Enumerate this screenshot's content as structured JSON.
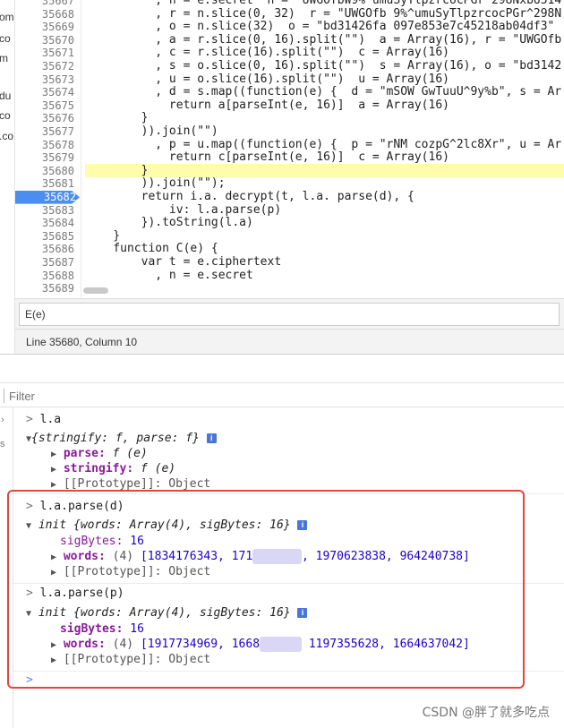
{
  "sidebar": {
    "fragments": [
      "om",
      "co",
      "m",
      "du",
      "co",
      ".co"
    ]
  },
  "editor": {
    "line_numbers": [
      "35667",
      "35668",
      "35669",
      "35670",
      "35671",
      "35672",
      "35673",
      "35674",
      "35675",
      "35676",
      "35677",
      "35678",
      "35679",
      "35680",
      "35681",
      "35682",
      "35683",
      "35684",
      "35685",
      "35686",
      "35687",
      "35688",
      "35689"
    ],
    "breakpoint_line": "35682",
    "highlighted_line": "35680",
    "lines": [
      "          , n = e.secret  n = \"UWGOfbW9%^umuSyTlpzrcocPGr^298NxbU514",
      "          , r = n.slice(0, 32)  r = \"UWGOfb 9%^umuSyTlpzrcocPGr^298N",
      "          , o = n.slice(32)  o = \"bd31426fa 097e853e7c45218ab04df3\"",
      "          , a = r.slice(0, 16).split(\"\")  a = Array(16), r = \"UWGOfb",
      "          , c = r.slice(16).split(\"\")  c = Array(16)",
      "          , s = o.slice(0, 16).split(\"\")  s = Array(16), o = \"bd3142",
      "          , u = o.slice(16).split(\"\")  u = Array(16)",
      "          , d = s.map((function(e) {  d = \"mSOW GwTuuU^9y%b\", s = Ar",
      "            return a[parseInt(e, 16)]  a = Array(16)",
      "        }",
      "        )).join(\"\")",
      "          , p = u.map((function(e) {  p = \"rNM cozpG^2lc8Xr\", u = Ar",
      "            return c[parseInt(e, 16)]  c = Array(16)",
      "        }",
      "        )).join(\"\");",
      "        return i.a. decrypt(t, l.a. parse(d), {",
      "            iv: l.a.parse(p)",
      "        }).toString(l.a)",
      "    }",
      "    function C(e) {",
      "        var t = e.ciphertext",
      "          , n = e.secret",
      ""
    ]
  },
  "search": {
    "value": "E(e)"
  },
  "status": {
    "text": "Line 35680, Column 10"
  },
  "filter": {
    "placeholder": "Filter"
  },
  "console": {
    "entries": [
      {
        "input": "l.a",
        "summary": "{stringify: f, parse: f}",
        "props": [
          {
            "key": "parse",
            "value": "f (e)"
          },
          {
            "key": "stringify",
            "value": "f (e)"
          },
          {
            "key": "[[Prototype]]",
            "value": "Object"
          }
        ]
      },
      {
        "input": "l.a.parse(d)",
        "summary_prefix": "init",
        "summary": "{words: Array(4), sigBytes: 16}",
        "sigBytes_label": "sigBytes",
        "sigBytes": "16",
        "words_label": "words",
        "words_count": "(4)",
        "words_a": "[1834176343, 171",
        "words_blur": "0046000",
        "words_b": ", 1970623838, 964240738]",
        "proto": "[[Prototype]]",
        "proto_value": "Object"
      },
      {
        "input": "l.a.parse(p)",
        "summary_prefix": "init",
        "summary": "{words: Array(4), sigBytes: 16}",
        "sigBytes_label": "sigBytes",
        "sigBytes": "16",
        "words_label": "words",
        "words_count": "(4)",
        "words_a": "[1917734969, 1668",
        "words_blur": "440834",
        "words_b": " 1197355628, 1664637042]",
        "proto": "[[Prototype]]",
        "proto_value": "Object"
      }
    ],
    "info_glyph": "i",
    "prompt": ">"
  },
  "watermark": "CSDN @胖了就多吃点",
  "colors": {
    "breakpoint": "#4a8ef0",
    "highlight": "#fffcab",
    "annotation_red": "#e5463c"
  }
}
